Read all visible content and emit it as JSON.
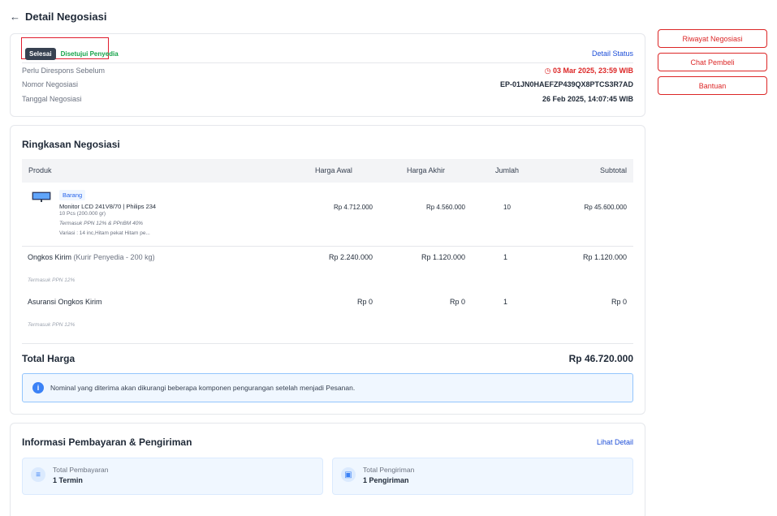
{
  "header": {
    "back_icon": "arrow-left-icon",
    "title": "Detail Negosiasi"
  },
  "status": {
    "badge": "Selesai",
    "state": "Disetujui Penyedia",
    "detail_link": "Detail Status",
    "rows": [
      {
        "label": "Perlu Direspons Sebelum",
        "value": "03 Mar 2025, 23:59 WIB"
      },
      {
        "label": "Nomor Negosiasi",
        "value": "EP-01JN0HAEFZP439QX8PTCS3R7AD"
      },
      {
        "label": "Tanggal Negosiasi",
        "value": "26 Feb 2025, 14:07:45 WIB"
      }
    ],
    "clock_icon": "clock-icon"
  },
  "summary": {
    "title": "Ringkasan Negosiasi",
    "columns": {
      "produk": "Produk",
      "harga_awal": "Harga Awal",
      "harga_akhir": "Harga Akhir",
      "jumlah": "Jumlah",
      "subtotal": "Subtotal"
    },
    "product": {
      "tag": "Barang",
      "name": "Monitor LCD 241V8/70 | Philips 234",
      "qty_weight": "10 Pcs (200.000 gr)",
      "tax_note": "Termasuk PPN 12% & PPnBM 40%",
      "variant": "Variasi   : 14 inc,Hitam pekat Hitam pe...",
      "harga_awal": "Rp 4.712.000",
      "harga_akhir": "Rp 4.560.000",
      "jumlah": "10",
      "subtotal": "Rp 45.600.000"
    },
    "shipping": {
      "label": "Ongkos Kirim",
      "courier": "(Kurir Penyedia - 200 kg)",
      "harga_awal": "Rp 2.240.000",
      "harga_akhir": "Rp 1.120.000",
      "jumlah": "1",
      "subtotal": "Rp 1.120.000",
      "note": "Termasuk PPN 12%"
    },
    "insurance": {
      "label": "Asuransi Ongkos Kirim",
      "harga_awal": "Rp 0",
      "harga_akhir": "Rp 0",
      "jumlah": "1",
      "subtotal": "Rp 0",
      "note": "Termasuk PPN 12%"
    },
    "total_label": "Total Harga",
    "total_value": "Rp 46.720.000",
    "notice": "Nominal yang diterima akan dikurangi beberapa komponen pengurangan setelah menjadi Pesanan."
  },
  "payment": {
    "title": "Informasi Pembayaran & Pengiriman",
    "link": "Lihat Detail",
    "boxes": [
      {
        "label": "Total Pembayaran",
        "value": "1 Termin",
        "icon": "layers-icon"
      },
      {
        "label": "Total Pengiriman",
        "value": "1 Pengiriman",
        "icon": "truck-icon"
      }
    ]
  },
  "side": {
    "history_button": "Riwayat Negosiasi",
    "chat_button": "Chat Pembeli",
    "help_button": "Bantuan"
  },
  "colors": {
    "accent_red": "#dc2626",
    "link_blue": "#1d4ed8",
    "success_green": "#16a34a"
  }
}
